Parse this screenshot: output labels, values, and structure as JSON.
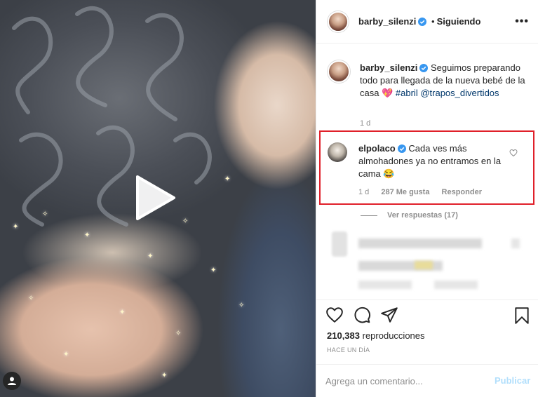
{
  "post": {
    "username": "barby_silenzi",
    "follow_status": "Siguiendo",
    "more_label": "•••",
    "caption": {
      "username": "barby_silenzi",
      "text_main": "Seguimos preparando todo para llegada de la nueva bebé de la casa",
      "emoji": "💖",
      "hashtag": "#abril",
      "mention": "@trapos_divertidos",
      "time": "1 d"
    }
  },
  "comment": {
    "username": "elpolaco",
    "text": "Cada ves más almohadones ya no entramos en la cama",
    "emoji": "😂",
    "time": "1 d",
    "likes": "287 Me gusta",
    "reply_label": "Responder",
    "view_replies": "Ver respuestas (17)"
  },
  "footer": {
    "views_count": "210,383",
    "views_label": "reproducciones",
    "date": "HACE UN DÍA",
    "input_placeholder": "Agrega un comentario...",
    "publish_label": "Publicar"
  },
  "colors": {
    "link": "#00376b",
    "verified": "#3897f0",
    "highlight": "#e0202a",
    "publish": "#b2dffc"
  },
  "icons": [
    "play-icon",
    "verified-icon",
    "more-icon",
    "heart-icon",
    "comment-icon",
    "share-icon",
    "bookmark-icon",
    "profile-icon"
  ]
}
